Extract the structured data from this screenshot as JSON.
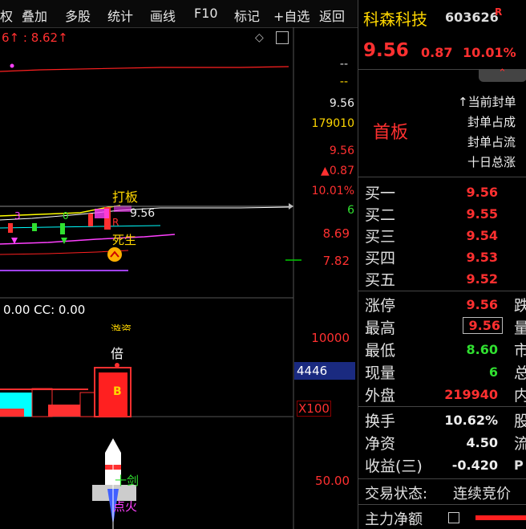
{
  "menu": [
    "权",
    "叠加",
    "多股",
    "统计",
    "画线",
    "F10",
    "标记",
    "+自选",
    "返回"
  ],
  "chart": {
    "top_readout": "6↑  : 8.62↑",
    "price_axis": {
      "dash1": "--",
      "dash2": "--",
      "p1": "9.56",
      "vol": "179010",
      "p2": "9.56",
      "chg": "▲0.87",
      "pct": "10.01%",
      "six": "6",
      "p3": "8.69",
      "p4": "7.82"
    },
    "cursor_price": "9.56",
    "annotations": {
      "daban": "打板",
      "shengsheng": "死生",
      "fan": "R",
      "num3": "3",
      "num0": "0"
    },
    "indicator_readout": "0.00  CC: 0.00",
    "vol_axis": {
      "v1": "10000",
      "v2": "4446",
      "v3": "X100"
    },
    "mult_label": "倍",
    "b_label": "B",
    "osc_axis": {
      "v1": "50.00"
    },
    "rocket_labels": {
      "jian": "十剑",
      "fire": "点火"
    },
    "top_partial": "游资"
  },
  "stock": {
    "name": "科森科技",
    "code": "603626",
    "badge": "R",
    "price": "9.56",
    "change": "0.87",
    "change_pct": "10.01%"
  },
  "limit_box": {
    "title": "首板",
    "lines": [
      "↑当前封单",
      "封单占成",
      "封单占流",
      "十日总涨"
    ]
  },
  "bids": [
    {
      "label": "买一",
      "price": "9.56"
    },
    {
      "label": "买二",
      "price": "9.55"
    },
    {
      "label": "买三",
      "price": "9.54"
    },
    {
      "label": "买四",
      "price": "9.53"
    },
    {
      "label": "买五",
      "price": "9.52"
    }
  ],
  "stats": [
    {
      "label": "涨停",
      "value": "9.56",
      "color": "#ff3030",
      "right": "跌"
    },
    {
      "label": "最高",
      "value": "9.56",
      "color": "#ff3030",
      "right": "量"
    },
    {
      "label": "最低",
      "value": "8.60",
      "color": "#30e030",
      "right": "市"
    },
    {
      "label": "现量",
      "value": "6",
      "color": "#30e030",
      "right": "总"
    },
    {
      "label": "外盘",
      "value": "219940",
      "color": "#ff3030",
      "right": "内"
    }
  ],
  "fundamentals": [
    {
      "label": "换手",
      "value": "10.62%",
      "right": "股"
    },
    {
      "label": "净资",
      "value": "4.50",
      "right": "流"
    },
    {
      "label": "收益(三)",
      "value": "-0.420",
      "right": "P"
    }
  ],
  "trade_status": {
    "label": "交易状态:",
    "value": "连续竞价"
  },
  "main_flow": {
    "label": "主力净额"
  },
  "colors": {
    "up": "#ff3030",
    "down": "#30e030",
    "accent": "#ffd700",
    "cyan": "#00e5ff"
  }
}
